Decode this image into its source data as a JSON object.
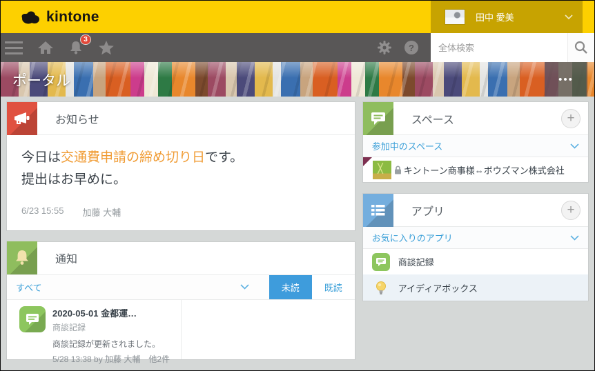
{
  "header": {
    "logo_text": "kintone",
    "user_name": "田中 愛美"
  },
  "toolbar": {
    "notification_count": "3",
    "search_placeholder": "全体検索"
  },
  "banner": {
    "title": "ポータル",
    "more_glyph": "•••"
  },
  "announcement": {
    "title": "お知らせ",
    "line1_prefix": "今日は",
    "line1_link": "交通費申請の締め切り日",
    "line1_suffix": "です。",
    "line2": "提出はお早めに。",
    "timestamp": "6/23 15:55",
    "author": "加藤 大輔"
  },
  "notifications": {
    "title": "通知",
    "filter_label": "すべて",
    "unread_label": "未読",
    "read_label": "既読",
    "items": [
      {
        "title": "2020-05-01 金都運…",
        "app": "商談記録",
        "message": "商談記録が更新されました。",
        "time": "5/28 13:38 by 加藤 大輔　他2件"
      }
    ]
  },
  "spaces": {
    "title": "スペース",
    "section_label": "参加中のスペース",
    "items": [
      {
        "name": "キントーン商事様⇔ボウズマン株式会社",
        "private": true
      }
    ]
  },
  "apps": {
    "title": "アプリ",
    "section_label": "お気に入りのアプリ",
    "items": [
      {
        "name": "商談記録",
        "icon": "chat-icon"
      },
      {
        "name": "アイディアボックス",
        "icon": "lightbulb-icon"
      }
    ]
  },
  "icons": {
    "plus_glyph": "+",
    "help_glyph": "?"
  },
  "colors": {
    "brand_yellow": "#fdd000",
    "user_area_gold": "#c7a301",
    "toolbar_gray": "#595757",
    "badge_red": "#e2493a",
    "link_orange": "#f09b33",
    "accent_blue": "#3e9cdc",
    "announce_red": "#e05140",
    "card_green": "#8fbd5e",
    "card_blue": "#74aede",
    "item_green": "#8dc65e",
    "unread_corner_maroon": "#7d2f50"
  }
}
